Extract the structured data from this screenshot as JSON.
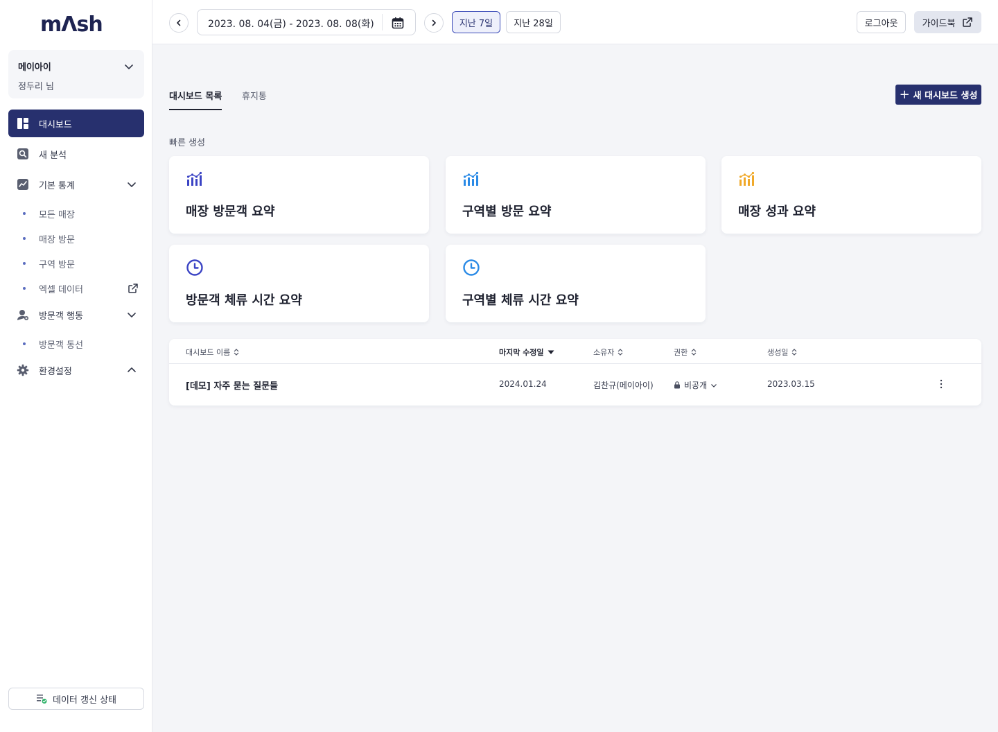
{
  "brand": {
    "logo": "mΛsh"
  },
  "org": {
    "name": "메이아이",
    "user": "정두리 님"
  },
  "nav": {
    "dashboard": "대시보드",
    "new_analysis": "새 분석",
    "basic_stats": "기본 통계",
    "basic_stats_items": [
      "모든 매장",
      "매장 방문",
      "구역 방문",
      "엑셀 데이터"
    ],
    "visitor_behavior": "방문객 행동",
    "visitor_behavior_items": [
      "방문객 동선"
    ],
    "settings": "환경설정"
  },
  "refresh": {
    "label": "데이터 갱신 상태"
  },
  "header": {
    "date_range": "2023. 08. 04(금) - 2023. 08. 08(화)",
    "preset_7": "지난 7일",
    "preset_28": "지난 28일",
    "logout": "로그아웃",
    "guide": "가이드북"
  },
  "tabs": {
    "list": "대시보드 목록",
    "trash": "휴지통"
  },
  "new_dashboard": {
    "plus": "+",
    "label": "새 대시보드 생성"
  },
  "quick": {
    "label": "빠른 생성",
    "cards": [
      {
        "title": "매장 방문객 요약",
        "icon": "bar-chart-icon"
      },
      {
        "title": "구역별 방문 요약",
        "icon": "bar-chart-icon"
      },
      {
        "title": "매장 성과 요약",
        "icon": "bar-chart-icon"
      },
      {
        "title": "방문객 체류 시간 요약",
        "icon": "clock-icon"
      },
      {
        "title": "구역별 체류 시간 요약",
        "icon": "clock-icon"
      }
    ]
  },
  "table": {
    "headers": {
      "name": "대시보드 이름",
      "modified": "마지막 수정일",
      "owner": "소유자",
      "permission": "권한",
      "created": "생성일"
    },
    "rows": [
      {
        "name": "[데모] 자주 묻는 질문들",
        "modified": "2024.01.24",
        "owner": "김찬규(메이아이)",
        "permission": "비공개",
        "created": "2023.03.15"
      }
    ]
  },
  "colors": {
    "primary": "#27306e",
    "card_icon_1": "#3b44c4",
    "card_icon_2": "#2a8ae6",
    "card_icon_3": "#f0a92a"
  }
}
